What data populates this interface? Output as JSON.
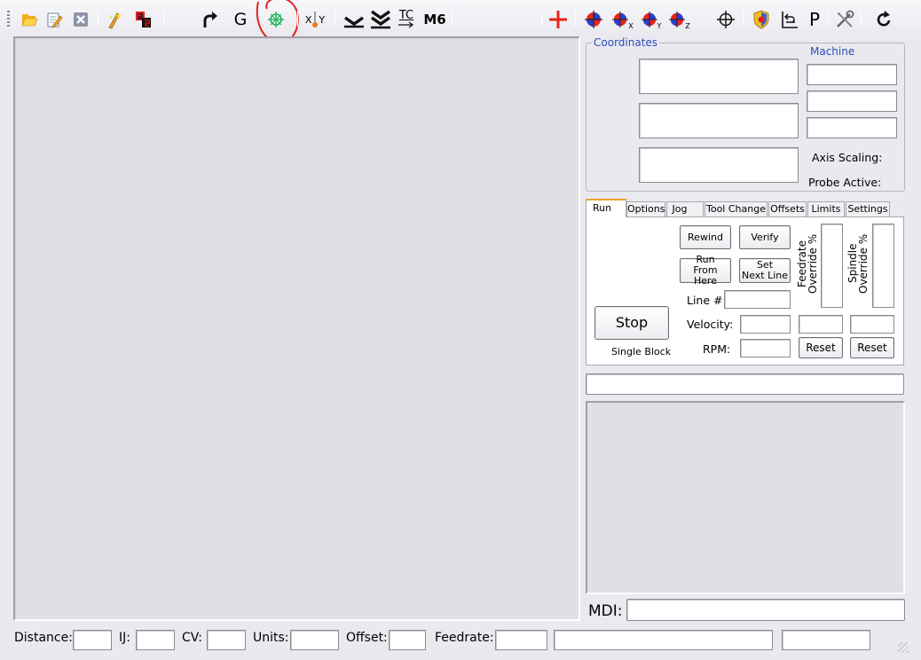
{
  "toolbar": {
    "icons": [
      "open-file",
      "edit-file",
      "close-file",
      "wizard",
      "post",
      "redo",
      "draw-g",
      "snap-center",
      "swap-xy",
      "lower-single",
      "lower-double",
      "tool-change",
      "m6",
      "crosshair-red",
      "zero-all",
      "zero-x",
      "zero-y",
      "zero-z",
      "target",
      "shield-check",
      "reverse",
      "parameters",
      "tools",
      "refresh"
    ],
    "text_g": "G",
    "text_x": "X",
    "text_y": "Y",
    "text_tc": "TC",
    "text_m6": "M6",
    "text_p": "P",
    "sub_x": "X",
    "sub_y": "Y",
    "sub_z": "Z",
    "accent_red": "#e8241c",
    "accent_blue": "#2a3fd0",
    "annotation_color": "#e02020"
  },
  "coordinates": {
    "title": "Coordinates",
    "machine_label": "Machine",
    "axis_scaling_label": "Axis Scaling:",
    "probe_active_label": "Probe Active:"
  },
  "tabs": [
    {
      "label": "Run",
      "active": true
    },
    {
      "label": "Options",
      "active": false
    },
    {
      "label": "Jog",
      "active": false
    },
    {
      "label": "Tool Change",
      "active": false
    },
    {
      "label": "Offsets",
      "active": false
    },
    {
      "label": "Limits",
      "active": false
    },
    {
      "label": "Settings",
      "active": false
    }
  ],
  "run": {
    "rewind": "Rewind",
    "verify": "Verify",
    "run_from_here_1": "Run",
    "run_from_here_2": "From Here",
    "set_next_line_1": "Set",
    "set_next_line_2": "Next Line",
    "line_label": "Line #:",
    "velocity_label": "Velocity:",
    "rpm_label": "RPM:",
    "stop": "Stop",
    "single_block": "Single Block",
    "feedrate_override_1": "Feedrate",
    "feedrate_override_2": "Override %",
    "spindle_override_1": "Spindle",
    "spindle_override_2": "Override %",
    "reset": "Reset"
  },
  "mdi": {
    "label": "MDI:"
  },
  "status": {
    "distance": "Distance:",
    "ij": "IJ:",
    "cv": "CV:",
    "units": "Units:",
    "offset": "Offset:",
    "feedrate": "Feedrate:"
  }
}
